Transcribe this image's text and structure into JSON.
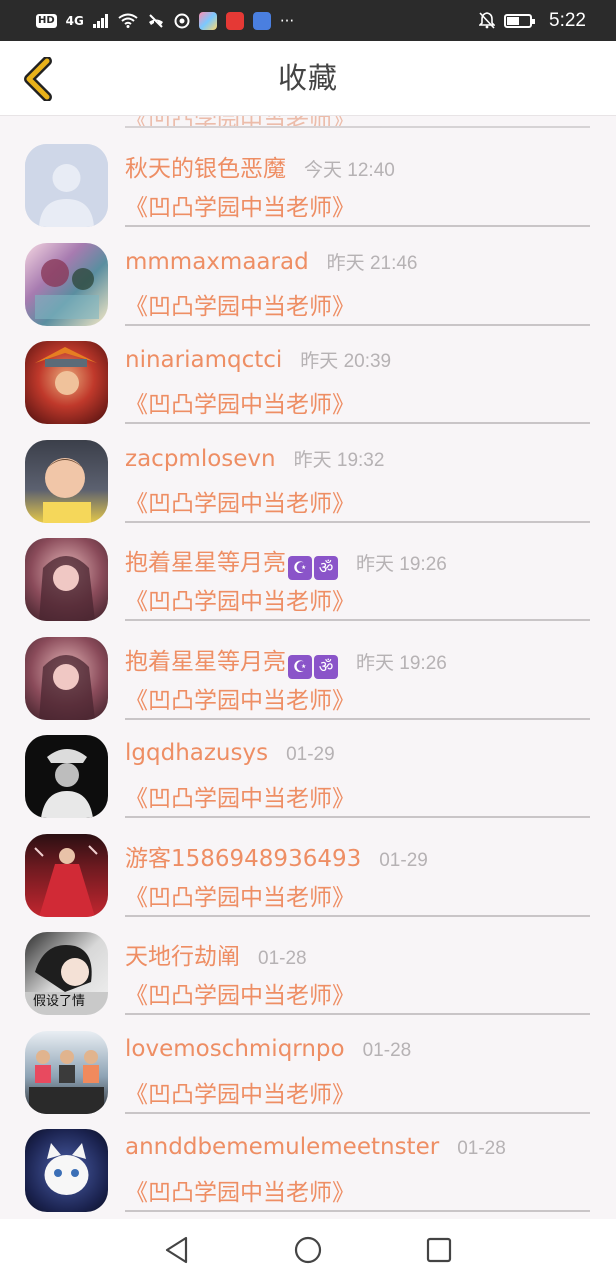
{
  "status_bar": {
    "hd": "HD",
    "signal": "4G",
    "time": "5:22",
    "icons": [
      "signal-icon",
      "wifi-icon",
      "call-off-icon",
      "vpn-icon",
      "app-icon-1",
      "app-icon-2",
      "music-app-icon",
      "more-icon",
      "bell-off-icon",
      "battery-icon"
    ],
    "more": "···"
  },
  "header": {
    "title": "收藏",
    "back_icon": "chevron-left-icon",
    "accent": "#e9b21a"
  },
  "partial_row": {
    "work": "《凹凸学园中当老师》"
  },
  "rows": [
    {
      "name": "秋天的银色恶魔",
      "time": "今天 12:40",
      "work": "《凹凸学园中当老师》",
      "emoji": ""
    },
    {
      "name": "mmmaxmaarad",
      "time": "昨天 21:46",
      "work": "《凹凸学园中当老师》",
      "emoji": ""
    },
    {
      "name": "ninariamqctci",
      "time": "昨天 20:39",
      "work": "《凹凸学园中当老师》",
      "emoji": ""
    },
    {
      "name": "zacpmlosevn",
      "time": "昨天 19:32",
      "work": "《凹凸学园中当老师》",
      "emoji": ""
    },
    {
      "name": "抱着星星等月亮",
      "time": "昨天 19:26",
      "work": "《凹凸学园中当老师》",
      "emoji": "☪ॐ"
    },
    {
      "name": "抱着星星等月亮",
      "time": "昨天 19:26",
      "work": "《凹凸学园中当老师》",
      "emoji": "☪ॐ"
    },
    {
      "name": "lgqdhazusys",
      "time": "01-29",
      "work": "《凹凸学园中当老师》",
      "emoji": ""
    },
    {
      "name": "游客1586948936493",
      "time": "01-29",
      "work": "《凹凸学园中当老师》",
      "emoji": ""
    },
    {
      "name": "天地行劫阐",
      "time": "01-28",
      "work": "《凹凸学园中当老师》",
      "emoji": ""
    },
    {
      "name": "lovemoschmiqrnpo",
      "time": "01-28",
      "work": "《凹凸学园中当老师》",
      "emoji": ""
    },
    {
      "name": "annddbememulemeetnster",
      "time": "01-28",
      "work": "《凹凸学园中当老师》",
      "emoji": ""
    }
  ],
  "avatar_overlay_text": "假设了情",
  "colors": {
    "name": "#ee8e64",
    "time": "#b6b2b4",
    "background": "#f8f5f7"
  },
  "nav": {
    "back": "nav-back-icon",
    "home": "nav-home-icon",
    "recents": "nav-recents-icon"
  }
}
